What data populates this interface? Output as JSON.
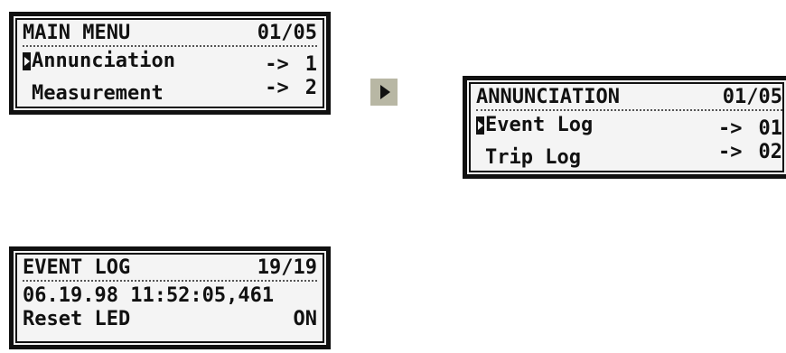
{
  "main_menu": {
    "title": "MAIN MENU",
    "page": "01/05",
    "items": [
      {
        "label": "Annunciation",
        "arrow": "->",
        "index": "1",
        "selected": true
      },
      {
        "label": "Measurement",
        "arrow": "->",
        "index": "2",
        "selected": false
      }
    ]
  },
  "navigate_icon": "right-arrow-icon",
  "annunciation": {
    "title": "ANNUNCIATION",
    "page": "01/05",
    "items": [
      {
        "label": "Event Log",
        "arrow": "->",
        "index": "01",
        "selected": true
      },
      {
        "label": "Trip Log",
        "arrow": "->",
        "index": "02",
        "selected": false
      }
    ]
  },
  "event_log": {
    "title": "EVENT LOG",
    "page": "19/19",
    "timestamp": "06.19.98 11:52:05,461",
    "event_label": "Reset LED",
    "event_state": "ON"
  }
}
